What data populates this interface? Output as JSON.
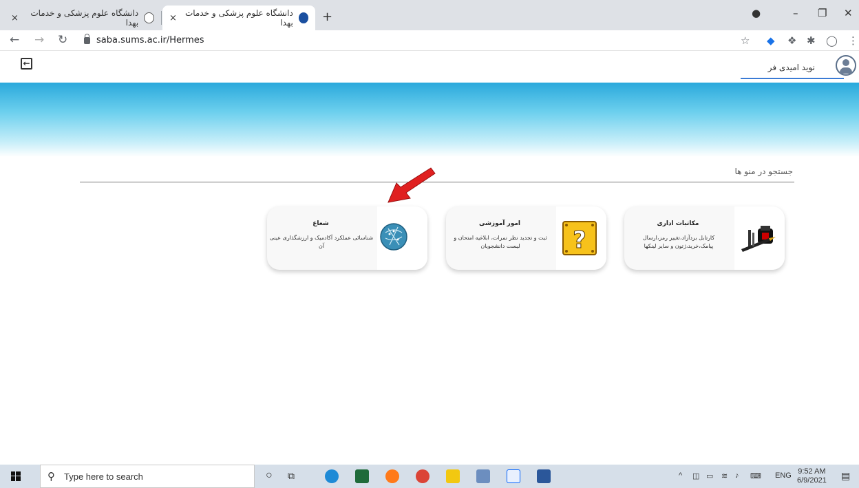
{
  "browser": {
    "tabs": [
      {
        "title": "دانشگاه علوم پزشکی و خدمات بهدا",
        "active": false
      },
      {
        "title": "دانشگاه علوم پزشکی و خدمات بهدا",
        "active": true
      }
    ],
    "new_tab_symbol": "+",
    "close_symbol": "×",
    "url": "saba.sums.ac.ir/Hermes"
  },
  "header": {
    "user_name": "نوید امیدی فر"
  },
  "search": {
    "label": "جستجو در منو ها"
  },
  "cards": [
    {
      "title": "مکاتبات اداری",
      "description": "کارتابل بردآزاد،تغییر رمز،ارسال پیامک،خرید،ژتون و سایر لینکها",
      "icon": "pen-inkwell-icon"
    },
    {
      "title": "امور آموزشی",
      "description": "ثبت و تجدید نظر نمرات، ابلاغیه امتحان و لیست دانشجویان",
      "icon": "question-block-icon"
    },
    {
      "title": "شعاع",
      "description": "شناسائی عملکرد آکادمیک و ارزشگذاری عینی آن",
      "icon": "shoa-logo-icon"
    }
  ],
  "taskbar": {
    "search_placeholder": "Type here to search",
    "language": "ENG",
    "time": "9:52 AM",
    "date": "6/9/2021"
  },
  "colors": {
    "banner_top": "#2aa9dc",
    "user_underline": "#3a7bd5",
    "arrow": "#e02020"
  }
}
